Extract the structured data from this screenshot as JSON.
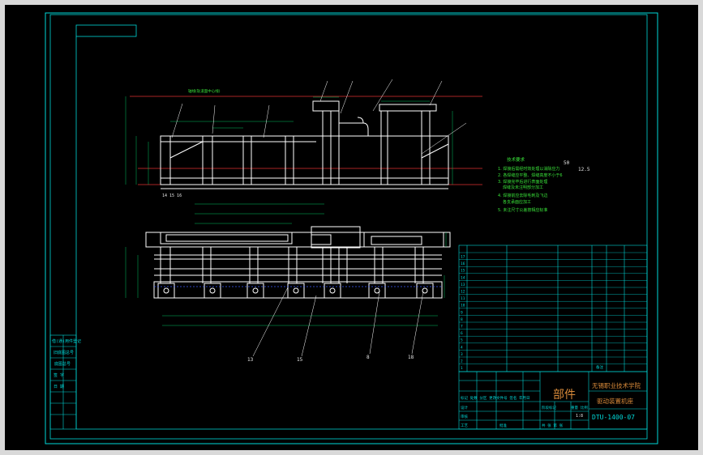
{
  "colors": {
    "background": "#000000",
    "frame": "#00d8d8",
    "outline": "#ffffff",
    "centerline": "#e03030",
    "dimension": "#00c060",
    "notes": "#39e239",
    "canvas_border": "#d9d9d9"
  },
  "title_block": {
    "part_word": "部件",
    "org_name": "无锡职业技术学院",
    "part_name": "驱动装置机座",
    "drawing_number": "DTU-1400-07",
    "scale": "1:8"
  },
  "tech_notes": {
    "heading": "技术要求"
  },
  "parts_list": {
    "item_numbers": [
      "17",
      "16",
      "15",
      "14",
      "13",
      "12",
      "11",
      "10",
      "9",
      "8",
      "7",
      "6",
      "5",
      "4",
      "3",
      "2",
      "1"
    ]
  },
  "balloons": [
    "13",
    "15",
    "8",
    "18"
  ],
  "side_table": {
    "rows": 8
  }
}
